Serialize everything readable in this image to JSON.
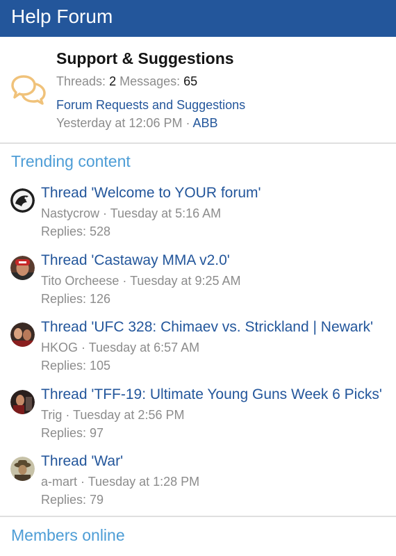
{
  "header": {
    "title": "Help Forum"
  },
  "forum": {
    "icon": "speech-bubbles-icon",
    "title": "Support & Suggestions",
    "threads_label": "Threads:",
    "threads_value": "2",
    "messages_label": "Messages:",
    "messages_value": "65",
    "latest_thread": "Forum Requests and Suggestions",
    "latest_time": "Yesterday at 12:06 PM",
    "separator": "·",
    "latest_user": "ABB"
  },
  "trending": {
    "title": "Trending content",
    "threads": [
      {
        "title": "Thread 'Welcome to YOUR forum'",
        "user": "Nastycrow",
        "time": "Tuesday at 5:16 AM",
        "replies": "Replies: 528"
      },
      {
        "title": "Thread 'Castaway MMA v2.0'",
        "user": "Tito Orcheese",
        "time": "Tuesday at 9:25 AM",
        "replies": "Replies: 126"
      },
      {
        "title": "Thread 'UFC 328: Chimaev vs. Strickland | Newark'",
        "user": "HKOG",
        "time": "Tuesday at 6:57 AM",
        "replies": "Replies: 105"
      },
      {
        "title": "Thread 'TFF-19: Ultimate Young Guns Week 6 Picks'",
        "user": "Trig",
        "time": "Tuesday at 2:56 PM",
        "replies": "Replies: 97"
      },
      {
        "title": "Thread 'War'",
        "user": "a-mart",
        "time": "Tuesday at 1:28 PM",
        "replies": "Replies: 79"
      }
    ]
  },
  "members_online": {
    "title": "Members online"
  },
  "colors": {
    "header_bg": "#23569b",
    "link": "#23569b",
    "section_title": "#4d9dd6",
    "muted": "#8c8c8c",
    "icon": "#f0c27a"
  }
}
